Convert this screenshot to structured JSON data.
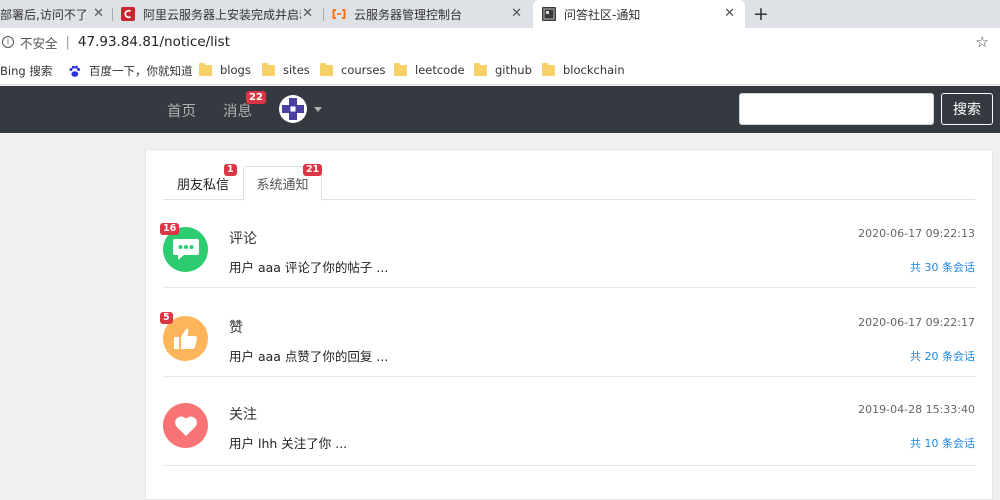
{
  "browser": {
    "tabs": [
      {
        "title": "部署后,访问不了_"
      },
      {
        "title": "阿里云服务器上安装完成并启动T"
      },
      {
        "title": "云服务器管理控制台"
      },
      {
        "title": "问答社区-通知"
      }
    ],
    "close_glyph": "✕",
    "new_tab_glyph": "+",
    "address": {
      "security_label": "不安全",
      "divider": "|",
      "url": "47.93.84.81/notice/list"
    },
    "bookmarks": [
      {
        "label": "Bing 搜索"
      },
      {
        "label": "百度一下，你就知道"
      },
      {
        "label": "blogs"
      },
      {
        "label": "sites"
      },
      {
        "label": "courses"
      },
      {
        "label": "leetcode"
      },
      {
        "label": "github"
      },
      {
        "label": "blockchain"
      }
    ]
  },
  "navbar": {
    "home_label": "首页",
    "messages_label": "消息",
    "messages_badge": "22",
    "search_placeholder": "",
    "search_button": "搜索"
  },
  "notice_tabs": [
    {
      "label": "朋友私信",
      "badge": "1"
    },
    {
      "label": "系统通知",
      "badge": "21"
    }
  ],
  "notices": [
    {
      "title": "评论",
      "badge": "16",
      "time": "2020-06-17 09:22:13",
      "desc": "用户 aaa 评论了你的帖子 ...",
      "count_text": "共 30 条会话",
      "icon": "comment-icon",
      "color": "#2ecc71"
    },
    {
      "title": "赞",
      "badge": "5",
      "time": "2020-06-17 09:22:17",
      "desc": "用户 aaa 点赞了你的回复 ...",
      "count_text": "共 20 条会话",
      "icon": "thumbs-up-icon",
      "color": "#fdb55b"
    },
    {
      "title": "关注",
      "badge": "",
      "time": "2019-04-28 15:33:40",
      "desc": "用户 lhh 关注了你 ...",
      "count_text": "共 10 条会话",
      "icon": "heart-icon",
      "color": "#f87474"
    }
  ],
  "colors": {
    "navbar_bg": "#343a40",
    "badge": "#dc3545",
    "link_blue": "#1e88e5"
  }
}
